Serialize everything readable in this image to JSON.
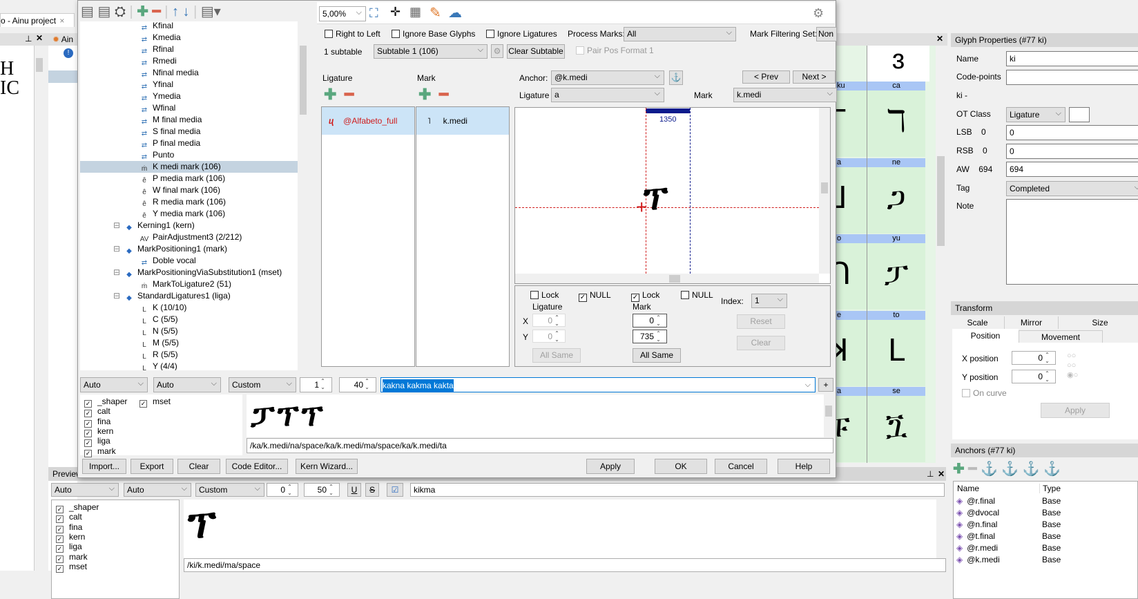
{
  "background_app": {
    "tab_title": "o - Ainu project",
    "panel_title": "Ain",
    "preview_panel": {
      "title": "Preview",
      "script_select": "Auto",
      "lang_select": "Auto",
      "mode_select": "Custom",
      "spacing_value": "0",
      "size_value": "50",
      "text_value": "kikma",
      "features": [
        {
          "name": "_shaper",
          "checked": true
        },
        {
          "name": "calt",
          "checked": true
        },
        {
          "name": "fina",
          "checked": true
        },
        {
          "name": "kern",
          "checked": true
        },
        {
          "name": "liga",
          "checked": true
        },
        {
          "name": "mark",
          "checked": true
        },
        {
          "name": "mset",
          "checked": true
        }
      ],
      "glyph_path": "/ki/k.medi/ma/space"
    },
    "glyph_grid": {
      "labels": [
        "ku",
        "ca",
        "a",
        "ne",
        "o",
        "yu",
        "e",
        "to",
        "a",
        "se"
      ]
    },
    "glyph_properties": {
      "title": "Glyph Properties (#77 ki)",
      "name_label": "Name",
      "name_value": "ki",
      "codepoints_label": "Code-points",
      "codepoints_value": "",
      "unicode_text": "ki -",
      "otclass_label": "OT Class",
      "otclass_value": "Ligature",
      "lsb_label": "LSB",
      "lsb_current": "0",
      "lsb_value": "0",
      "rsb_label": "RSB",
      "rsb_current": "0",
      "rsb_value": "0",
      "aw_label": "AW",
      "aw_current": "694",
      "aw_value": "694",
      "tag_label": "Tag",
      "tag_value": "Completed",
      "note_label": "Note"
    },
    "transform": {
      "title": "Transform",
      "tabs": [
        "Scale",
        "Mirror",
        "Size",
        "Position",
        "Movement"
      ],
      "active_tab": "Position",
      "x_label": "X position",
      "x_value": "0",
      "y_label": "Y position",
      "y_value": "0",
      "on_curve_label": "On curve",
      "apply_label": "Apply"
    },
    "anchors": {
      "title": "Anchors (#77 ki)",
      "columns": [
        "Name",
        "Type"
      ],
      "rows": [
        {
          "name": "@r.final",
          "type": "Base"
        },
        {
          "name": "@dvocal",
          "type": "Base"
        },
        {
          "name": "@n.final",
          "type": "Base"
        },
        {
          "name": "@t.final",
          "type": "Base"
        },
        {
          "name": "@r.medi",
          "type": "Base"
        },
        {
          "name": "@k.medi",
          "type": "Base"
        }
      ]
    }
  },
  "dialog": {
    "tree": [
      {
        "label": "Kfinal",
        "icon": "substitution-icon",
        "level": 2
      },
      {
        "label": "Kmedia",
        "icon": "substitution-icon",
        "level": 2
      },
      {
        "label": "Rfinal",
        "icon": "substitution-icon",
        "level": 2
      },
      {
        "label": "Rmedi",
        "icon": "substitution-icon",
        "level": 2
      },
      {
        "label": "Nfinal media",
        "icon": "substitution-icon",
        "level": 2
      },
      {
        "label": "Yfinal",
        "icon": "substitution-icon",
        "level": 2
      },
      {
        "label": "Ymedia",
        "icon": "substitution-icon",
        "level": 2
      },
      {
        "label": "Wfinal",
        "icon": "substitution-icon",
        "level": 2
      },
      {
        "label": "M final media",
        "icon": "substitution-icon",
        "level": 2
      },
      {
        "label": "S final media",
        "icon": "substitution-icon",
        "level": 2
      },
      {
        "label": "P final media",
        "icon": "substitution-icon",
        "level": 2
      },
      {
        "label": "Punto",
        "icon": "substitution-icon",
        "level": 2
      },
      {
        "label": "K medi mark (106)",
        "icon": "mark-to-ligature-icon",
        "level": 2,
        "selected": true
      },
      {
        "label": "P media mark (106)",
        "icon": "mark-to-base-icon",
        "level": 2
      },
      {
        "label": "W final mark (106)",
        "icon": "mark-to-base-icon",
        "level": 2
      },
      {
        "label": "R media mark (106)",
        "icon": "mark-to-base-icon",
        "level": 2
      },
      {
        "label": "Y media mark (106)",
        "icon": "mark-to-base-icon",
        "level": 2
      },
      {
        "label": "Kerning1 (kern)",
        "icon": "feature-icon",
        "level": 1
      },
      {
        "label": "PairAdjustment3 (2/212)",
        "icon": "kern-pair-icon",
        "level": 2
      },
      {
        "label": "MarkPositioning1 (mark)",
        "icon": "feature-icon",
        "level": 1
      },
      {
        "label": "Doble vocal",
        "icon": "substitution-icon",
        "level": 2
      },
      {
        "label": "MarkPositioningViaSubstitution1 (mset)",
        "icon": "feature-icon",
        "level": 1
      },
      {
        "label": "MarkToLigature2 (51)",
        "icon": "mark-to-ligature-icon",
        "level": 2
      },
      {
        "label": "StandardLigatures1 (liga)",
        "icon": "feature-icon",
        "level": 1
      },
      {
        "label": "K (10/10)",
        "icon": "ligature-icon",
        "level": 2
      },
      {
        "label": "C (5/5)",
        "icon": "ligature-icon",
        "level": 2
      },
      {
        "label": "N (5/5)",
        "icon": "ligature-icon",
        "level": 2
      },
      {
        "label": "M (5/5)",
        "icon": "ligature-icon",
        "level": 2
      },
      {
        "label": "R (5/5)",
        "icon": "ligature-icon",
        "level": 2
      },
      {
        "label": "Y (4/4)",
        "icon": "ligature-icon",
        "level": 2
      }
    ],
    "zoom": "5,00%",
    "options": {
      "right_to_left": {
        "label": "Right to Left",
        "checked": false
      },
      "ignore_base": {
        "label": "Ignore Base Glyphs",
        "checked": false
      },
      "ignore_lig": {
        "label": "Ignore Ligatures",
        "checked": false
      },
      "process_marks_label": "Process Marks:",
      "process_marks_value": "All",
      "mark_filter_label": "Mark Filtering Set:",
      "mark_filter_value": "Non"
    },
    "subtable_count": "1 subtable",
    "subtable_value": "Subtable 1 (106)",
    "clear_subtable": "Clear Subtable",
    "pair_pos": "Pair Pos Format 1",
    "ligature_header": "Ligature",
    "mark_header": "Mark",
    "ligature_item": "@Alfabeto_full",
    "mark_item": "k.medi",
    "anchor_label": "Anchor:",
    "anchor_value": "@k.medi",
    "ligature_label": "Ligature",
    "ligature_value": "a",
    "mark_label": "Mark",
    "mark_value": "k.medi",
    "prev": "< Prev",
    "next": "Next >",
    "advance_label": "1350",
    "lig_lock": {
      "label": "Lock",
      "checked": false
    },
    "lig_null": {
      "label": "NULL",
      "checked": true
    },
    "mark_lock": {
      "label": "Lock",
      "checked": true
    },
    "mark_null": {
      "label": "NULL",
      "checked": false
    },
    "lig_group": "Ligature",
    "mark_group": "Mark",
    "x_label": "X",
    "y_label": "Y",
    "lig_x": "0",
    "lig_y": "0",
    "mark_x": "0",
    "mark_y": "735",
    "all_same": "All Same",
    "index_label": "Index:",
    "index_value": "1",
    "reset": "Reset",
    "clear": "Clear",
    "preview": {
      "script_select": "Auto",
      "lang_select": "Auto",
      "mode_select": "Custom",
      "spacing_value": "1",
      "size_value": "40",
      "text_value": "kakna kakma kakta",
      "add": "+",
      "features": [
        {
          "name": "_shaper",
          "checked": true
        },
        {
          "name": "mset",
          "checked": true
        },
        {
          "name": "calt",
          "checked": true
        },
        {
          "name": "fina",
          "checked": true
        },
        {
          "name": "kern",
          "checked": true
        },
        {
          "name": "liga",
          "checked": true
        },
        {
          "name": "mark",
          "checked": true
        }
      ],
      "glyph_path": "/ka/k.medi/na/space/ka/k.medi/ma/space/ka/k.medi/ta"
    },
    "buttons": {
      "import": "Import...",
      "export": "Export",
      "clear": "Clear",
      "code_editor": "Code Editor...",
      "kern_wizard": "Kern Wizard...",
      "apply": "Apply",
      "ok": "OK",
      "cancel": "Cancel",
      "help": "Help"
    }
  },
  "colors": {
    "accent": "#0078d7",
    "selection": "#cce4f7",
    "tree_selection": "#c4d3e0",
    "glyph_grid": "#d9f2d9",
    "grid_label": "#a9c6f5",
    "plus": "#5aa77e",
    "minus": "#d9634c"
  }
}
